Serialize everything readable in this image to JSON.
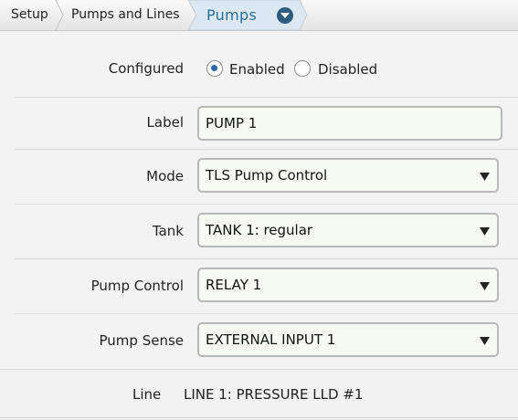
{
  "breadcrumb": {
    "items": [
      "Setup",
      "Pumps and Lines"
    ],
    "current": "Pumps"
  },
  "form": {
    "configured": {
      "label": "Configured",
      "options": [
        "Enabled",
        "Disabled"
      ],
      "selected": "Enabled"
    },
    "label_field": {
      "label": "Label",
      "value": "PUMP 1"
    },
    "mode": {
      "label": "Mode",
      "value": "TLS Pump Control"
    },
    "tank": {
      "label": "Tank",
      "value": "TANK 1: regular"
    },
    "pump_control": {
      "label": "Pump Control",
      "value": "RELAY 1"
    },
    "pump_sense": {
      "label": "Pump Sense",
      "value": "EXTERNAL INPUT 1"
    }
  },
  "line": {
    "label": "Line",
    "value": "LINE 1: PRESSURE LLD #1"
  },
  "colors": {
    "accent": "#2b6e96",
    "dropdown_icon": "#2d5e80",
    "field_background": "#f7fbf4"
  }
}
